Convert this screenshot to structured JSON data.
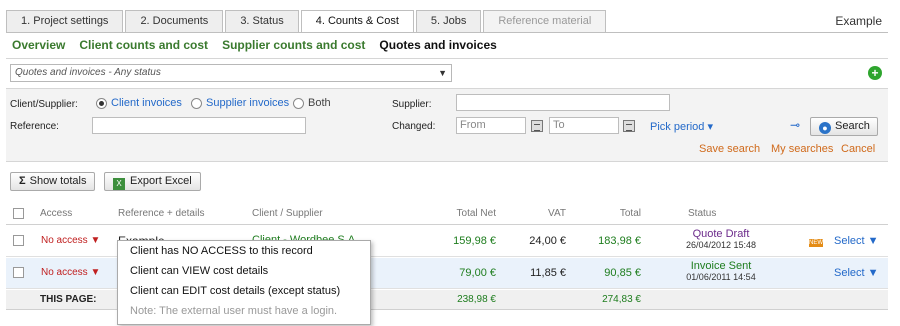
{
  "tabs": [
    {
      "label": "1. Project settings",
      "state": "normal"
    },
    {
      "label": "2. Documents",
      "state": "normal"
    },
    {
      "label": "3. Status",
      "state": "normal"
    },
    {
      "label": "4. Counts & Cost",
      "state": "active"
    },
    {
      "label": "5. Jobs",
      "state": "normal"
    },
    {
      "label": "Reference material",
      "state": "disabled"
    }
  ],
  "example_link": "Example",
  "subnav": [
    "Overview",
    "Client counts and cost",
    "Supplier counts and cost",
    "Quotes and invoices"
  ],
  "view_select": "Quotes and invoices - Any status",
  "filters": {
    "client_supplier_label": "Client/Supplier:",
    "radios": [
      "Client invoices",
      "Supplier invoices",
      "Both"
    ],
    "reference_label": "Reference:",
    "supplier_label": "Supplier:",
    "changed_label": "Changed:",
    "from_placeholder": "From",
    "to_placeholder": "To",
    "pick_period": "Pick period ▾",
    "search_button": "Search",
    "save_search": "Save search",
    "my_searches": "My searches",
    "cancel": "Cancel"
  },
  "toolbar": {
    "show_totals": "Show totals",
    "export_excel": "Export Excel"
  },
  "table": {
    "headers": [
      "Access",
      "Reference + details",
      "Client / Supplier",
      "Total Net",
      "VAT",
      "Total",
      "Status"
    ],
    "rows": [
      {
        "access": "No access",
        "reference": "Example",
        "client": "Client - Wordbee S.A.",
        "net": "159,98 €",
        "vat": "24,00 €",
        "total": "183,98 €",
        "status": "Quote Draft",
        "timestamp": "26/04/2012 15:48",
        "select": "Select",
        "new_badge": "NEW"
      },
      {
        "access": "No access",
        "reference": "",
        "client": "",
        "net": "79,00 €",
        "vat": "11,85 €",
        "total": "90,85 €",
        "status": "Invoice Sent",
        "timestamp": "01/06/2011 14:54",
        "select": "Select"
      }
    ],
    "totals": {
      "label": "THIS PAGE:",
      "net": "238,98 €",
      "total": "274,83 €"
    }
  },
  "access_menu": [
    "Client has NO ACCESS to this record",
    "Client can VIEW cost details",
    "Client can EDIT cost details (except status)",
    "Note: The external user must have a login."
  ]
}
